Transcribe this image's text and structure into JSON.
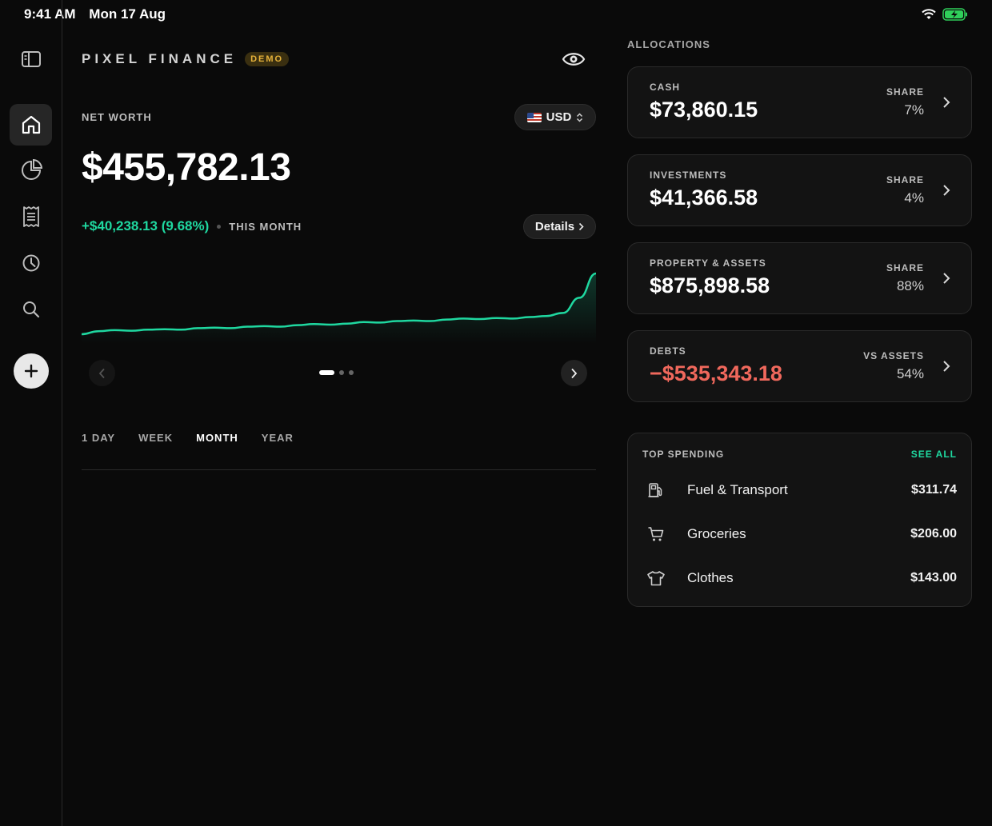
{
  "status_bar": {
    "time": "9:41 AM",
    "date": "Mon 17 Aug"
  },
  "header": {
    "brand": "PIXEL FINANCE",
    "badge": "DEMO"
  },
  "net_worth": {
    "label": "NET WORTH",
    "value": "$455,782.13",
    "currency": "USD",
    "change": "+$40,238.13 (9.68%)",
    "period": "THIS MONTH",
    "details_label": "Details"
  },
  "chart_data": {
    "type": "line",
    "series": [
      {
        "values": [
          0.0,
          0.6,
          0.8,
          0.7,
          0.9,
          1.0,
          0.9,
          1.2,
          1.3,
          1.2,
          1.5,
          1.6,
          1.5,
          1.8,
          2.0,
          1.9,
          2.1,
          2.4,
          2.3,
          2.6,
          2.7,
          2.6,
          2.9,
          3.1,
          3.0,
          3.2,
          3.1,
          3.4,
          3.6,
          4.2,
          7.2,
          12.0
        ]
      }
    ],
    "color": "#1fd8a0",
    "grid": false,
    "ylim": [
      0,
      12
    ]
  },
  "pager": {
    "count": 3,
    "active": 0
  },
  "time_ranges": [
    {
      "label": "1 DAY",
      "active": false
    },
    {
      "label": "WEEK",
      "active": false
    },
    {
      "label": "MONTH",
      "active": true
    },
    {
      "label": "YEAR",
      "active": false
    }
  ],
  "allocations": {
    "heading": "ALLOCATIONS",
    "cards": [
      {
        "label": "CASH",
        "value": "$73,860.15",
        "share_label": "SHARE",
        "share": "7%"
      },
      {
        "label": "INVESTMENTS",
        "value": "$41,366.58",
        "share_label": "SHARE",
        "share": "4%"
      },
      {
        "label": "PROPERTY & ASSETS",
        "value": "$875,898.58",
        "share_label": "SHARE",
        "share": "88%"
      },
      {
        "label": "DEBTS",
        "value": "−$535,343.18",
        "share_label": "VS ASSETS",
        "share": "54%"
      }
    ]
  },
  "top_spending": {
    "heading": "TOP SPENDING",
    "see_all": "SEE ALL",
    "items": [
      {
        "icon": "fuel-icon",
        "name": "Fuel & Transport",
        "amount": "$311.74"
      },
      {
        "icon": "cart-icon",
        "name": "Groceries",
        "amount": "$206.00"
      },
      {
        "icon": "shirt-icon",
        "name": "Clothes",
        "amount": "$143.00"
      }
    ]
  },
  "colors": {
    "accent": "#1fd8a0",
    "negative": "#f0685c",
    "badge": "#e6b23a"
  }
}
